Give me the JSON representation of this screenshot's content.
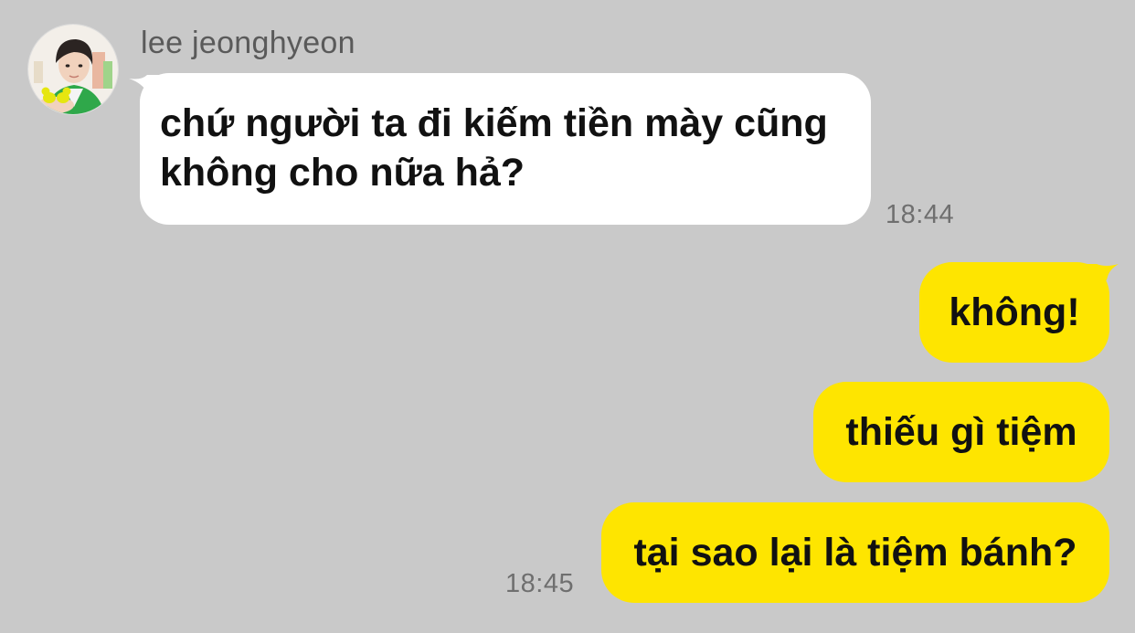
{
  "chat": {
    "contact": {
      "name": "lee jeonghyeon",
      "avatar_icon": "profile-photo-avatar"
    },
    "messages": [
      {
        "direction": "incoming",
        "lines": [
          "chứ người ta đi kiếm tiền mày cũng",
          "không cho nữa hả?"
        ],
        "time": "18:44"
      },
      {
        "direction": "outgoing",
        "text": "không!"
      },
      {
        "direction": "outgoing",
        "text": "thiếu gì tiệm"
      },
      {
        "direction": "outgoing",
        "text": "tại sao lại là tiệm bánh?",
        "time": "18:45"
      }
    ]
  },
  "colors": {
    "background": "#c9c9c9",
    "incoming_bubble": "#ffffff",
    "outgoing_bubble": "#fee500",
    "text": "#111111",
    "timestamp": "#6f6f6f"
  }
}
